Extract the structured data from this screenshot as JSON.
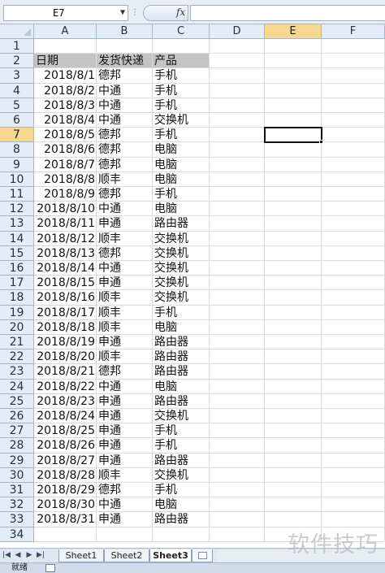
{
  "formula_bar": {
    "name_box": "E7",
    "fx_label": "fx",
    "formula": ""
  },
  "columns": [
    "A",
    "B",
    "C",
    "D",
    "E",
    "F"
  ],
  "active": {
    "col": "E",
    "row": 7
  },
  "header_row": [
    "日期",
    "发货快递",
    "产品"
  ],
  "rows": [
    [
      "2018/8/1",
      "德邦",
      "手机"
    ],
    [
      "2018/8/2",
      "中通",
      "手机"
    ],
    [
      "2018/8/3",
      "中通",
      "手机"
    ],
    [
      "2018/8/4",
      "中通",
      "交换机"
    ],
    [
      "2018/8/5",
      "德邦",
      "手机"
    ],
    [
      "2018/8/6",
      "德邦",
      "电脑"
    ],
    [
      "2018/8/7",
      "德邦",
      "电脑"
    ],
    [
      "2018/8/8",
      "顺丰",
      "电脑"
    ],
    [
      "2018/8/9",
      "德邦",
      "手机"
    ],
    [
      "2018/8/10",
      "中通",
      "电脑"
    ],
    [
      "2018/8/11",
      "申通",
      "路由器"
    ],
    [
      "2018/8/12",
      "顺丰",
      "交换机"
    ],
    [
      "2018/8/13",
      "德邦",
      "交换机"
    ],
    [
      "2018/8/14",
      "中通",
      "交换机"
    ],
    [
      "2018/8/15",
      "申通",
      "交换机"
    ],
    [
      "2018/8/16",
      "顺丰",
      "交换机"
    ],
    [
      "2018/8/17",
      "顺丰",
      "手机"
    ],
    [
      "2018/8/18",
      "顺丰",
      "电脑"
    ],
    [
      "2018/8/19",
      "申通",
      "路由器"
    ],
    [
      "2018/8/20",
      "顺丰",
      "路由器"
    ],
    [
      "2018/8/21",
      "德邦",
      "路由器"
    ],
    [
      "2018/8/22",
      "中通",
      "电脑"
    ],
    [
      "2018/8/23",
      "申通",
      "路由器"
    ],
    [
      "2018/8/24",
      "申通",
      "交换机"
    ],
    [
      "2018/8/25",
      "申通",
      "手机"
    ],
    [
      "2018/8/26",
      "申通",
      "手机"
    ],
    [
      "2018/8/27",
      "申通",
      "路由器"
    ],
    [
      "2018/8/28",
      "顺丰",
      "交换机"
    ],
    [
      "2018/8/29",
      "德邦",
      "手机"
    ],
    [
      "2018/8/30",
      "中通",
      "电脑"
    ],
    [
      "2018/8/31",
      "申通",
      "路由器"
    ]
  ],
  "sheet_tabs": [
    "Sheet1",
    "Sheet2",
    "Sheet3"
  ],
  "active_sheet": "Sheet3",
  "status": "就绪",
  "watermark": "软件技巧",
  "colors": {
    "header_bg": "#e4ecf7",
    "selected_header_bg": "#f8d88e",
    "data_header_fill": "#c4c4c4",
    "gridline": "#d6dce5"
  }
}
